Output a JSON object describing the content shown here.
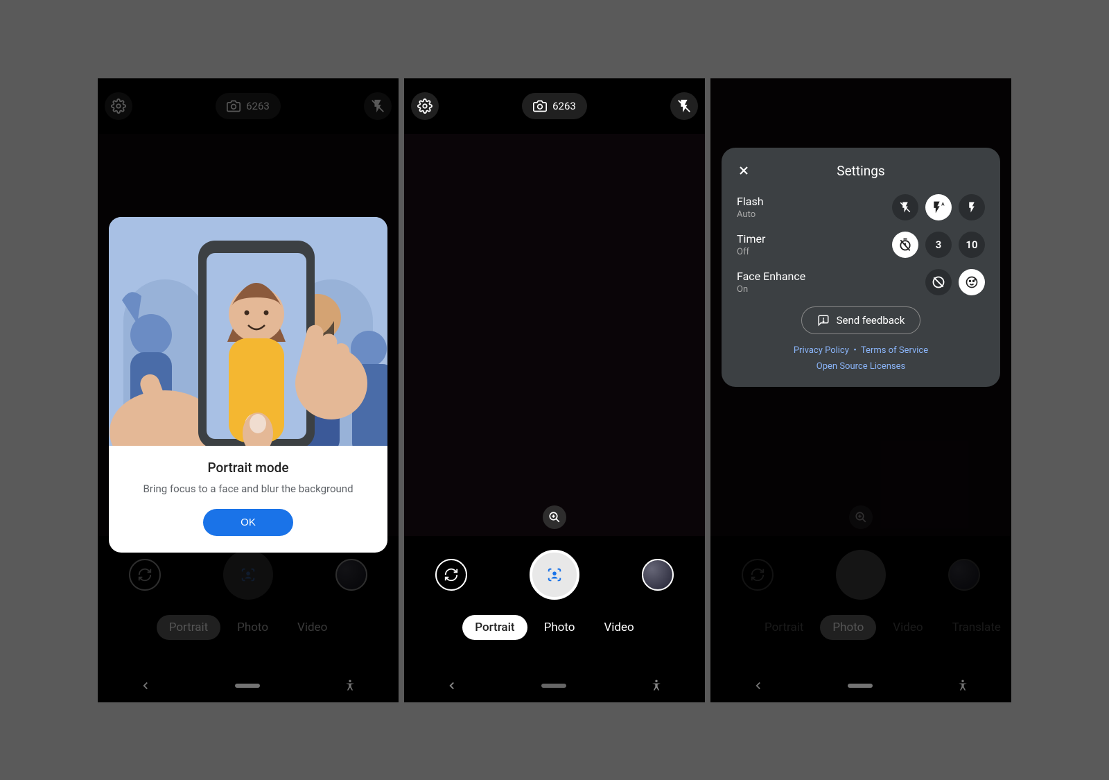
{
  "top": {
    "photo_count": "6263"
  },
  "popup": {
    "title": "Portrait mode",
    "desc": "Bring focus to a face and blur the background",
    "ok": "OK"
  },
  "modes": {
    "portrait": "Portrait",
    "photo": "Photo",
    "video": "Video",
    "translate": "Translate"
  },
  "settings": {
    "title": "Settings",
    "flash": {
      "label": "Flash",
      "value": "Auto"
    },
    "timer": {
      "label": "Timer",
      "value": "Off",
      "opt3": "3",
      "opt10": "10"
    },
    "face": {
      "label": "Face Enhance",
      "value": "On"
    },
    "feedback": "Send feedback",
    "privacy": "Privacy Policy",
    "tos": "Terms of Service",
    "oss": "Open Source Licenses"
  }
}
